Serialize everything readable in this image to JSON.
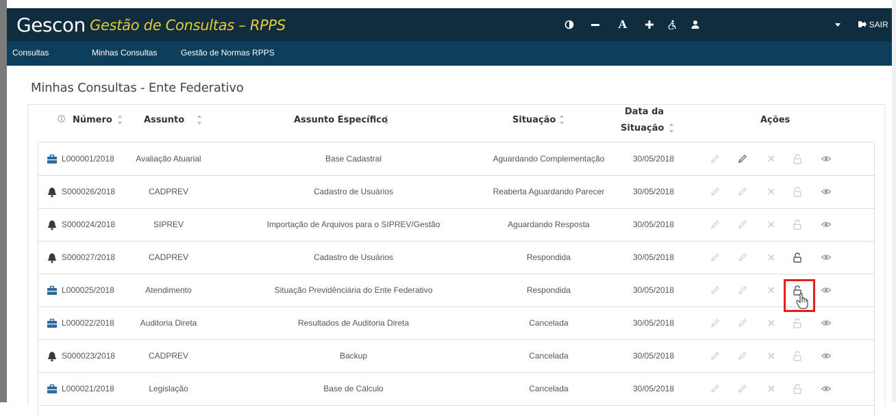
{
  "header": {
    "brand": "Gescon",
    "subtitle": "Gestão de Consultas – RPPS",
    "tools": [
      {
        "name": "contrast-icon",
        "glyph": "◐"
      },
      {
        "name": "font-decrease-button",
        "glyph": "−"
      },
      {
        "name": "font-reset-button",
        "glyph": "A"
      },
      {
        "name": "font-increase-button",
        "glyph": "+"
      },
      {
        "name": "accessibility-icon",
        "glyph": "♿"
      },
      {
        "name": "user-icon",
        "glyph": "👤"
      }
    ],
    "exit_label": "SAIR"
  },
  "nav": {
    "items": [
      "Consultas",
      "Minhas Consultas",
      "Gestão de Normas RPPS"
    ]
  },
  "page": {
    "title": "Minhas Consultas - Ente Federativo"
  },
  "table": {
    "headers": {
      "numero": "Número",
      "assunto": "Assunto",
      "assunto_especifico": "Assunto Específico",
      "situacao": "Situação",
      "data_line1": "Data da",
      "data_line2": "Situação",
      "acoes": "Ações"
    },
    "rows": [
      {
        "type": "briefcase",
        "numero": "L000001/2018",
        "assunto": "Avaliação Atuarial",
        "especifico": "Base Cadastral",
        "situacao": "Aguardando Complementação",
        "data": "30/05/2018",
        "edit2_active": true,
        "unlock_active": false
      },
      {
        "type": "bell",
        "numero": "S000026/2018",
        "assunto": "CADPREV",
        "especifico": "Cadastro de Usuários",
        "situacao": "Reaberta Aguardando Parecer",
        "data": "30/05/2018",
        "edit2_active": false,
        "unlock_active": false
      },
      {
        "type": "bell",
        "numero": "S000024/2018",
        "assunto": "SIPREV",
        "especifico": "Importação de Arquivos para o SIPREV/Gestão",
        "situacao": "Aguardando Resposta",
        "data": "30/05/2018",
        "edit2_active": false,
        "unlock_active": false
      },
      {
        "type": "bell",
        "numero": "S000027/2018",
        "assunto": "CADPREV",
        "especifico": "Cadastro de Usuários",
        "situacao": "Respondida",
        "data": "30/05/2018",
        "edit2_active": false,
        "unlock_active": true
      },
      {
        "type": "briefcase",
        "numero": "L000025/2018",
        "assunto": "Atendimento",
        "especifico": "Situação Previdênciária do Ente Federativo",
        "situacao": "Respondida",
        "data": "30/05/2018",
        "edit2_active": false,
        "unlock_active": true
      },
      {
        "type": "briefcase",
        "numero": "L000022/2018",
        "assunto": "Auditoria Direta",
        "especifico": "Resultados de Auditoria Direta",
        "situacao": "Cancelada",
        "data": "30/05/2018",
        "edit2_active": false,
        "unlock_active": false
      },
      {
        "type": "bell",
        "numero": "S000023/2018",
        "assunto": "CADPREV",
        "especifico": "Backup",
        "situacao": "Cancelada",
        "data": "30/05/2018",
        "edit2_active": false,
        "unlock_active": false
      },
      {
        "type": "briefcase",
        "numero": "L000021/2018",
        "assunto": "Legislação",
        "especifico": "Base de Cálculo",
        "situacao": "Cancelada",
        "data": "30/05/2018",
        "edit2_active": false,
        "unlock_active": false
      }
    ]
  },
  "colors": {
    "topbar": "#0e2e3f",
    "navbar": "#0d3f5c",
    "brand_accent": "#e8c83a",
    "icon_active": "#555555",
    "icon_inactive": "#d0d0d0",
    "highlight": "#e02020"
  }
}
